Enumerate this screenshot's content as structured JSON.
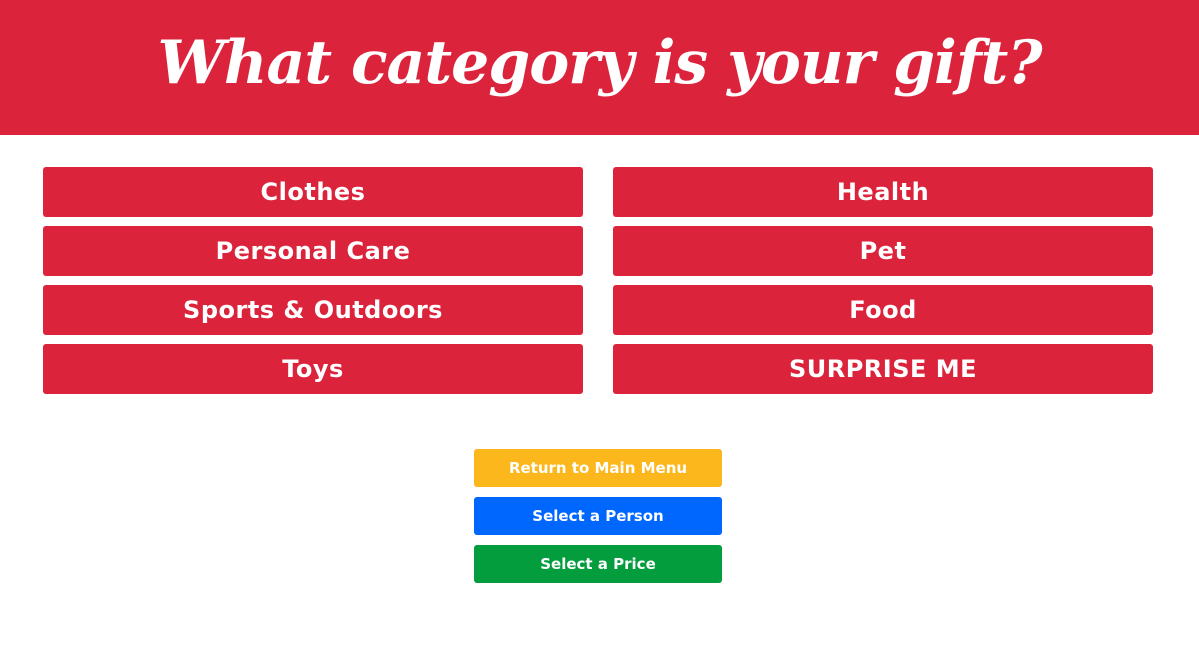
{
  "header": {
    "title": "What category is your gift?"
  },
  "categories": {
    "left": [
      "Clothes",
      "Personal Care",
      "Sports & Outdoors",
      "Toys"
    ],
    "right": [
      "Health",
      "Pet",
      "Food",
      "SURPRISE ME"
    ]
  },
  "actions": {
    "main_menu": "Return to Main Menu",
    "select_person": "Select a Person",
    "select_price": "Select a Price"
  },
  "colors": {
    "primary_red": "#dc233c",
    "yellow": "#fbb71c",
    "blue": "#0067fe",
    "green": "#049d3e",
    "text": "#ffffff"
  }
}
